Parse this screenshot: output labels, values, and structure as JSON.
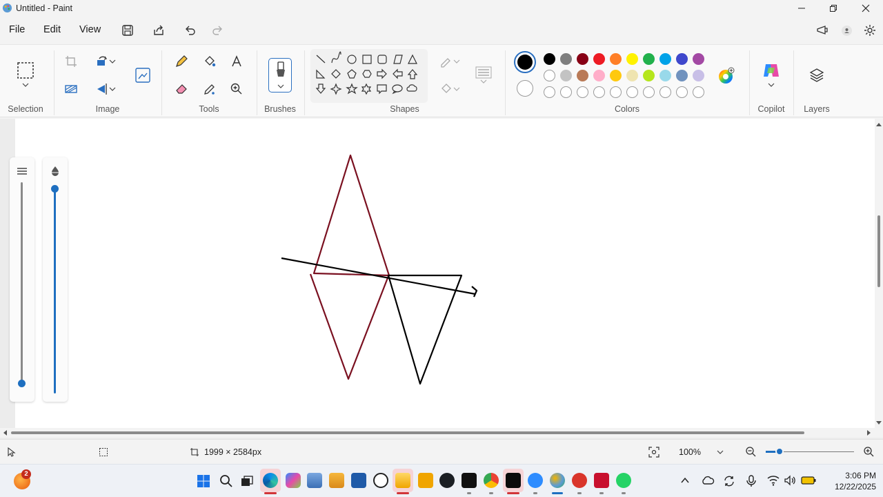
{
  "window": {
    "title": "Untitled - Paint",
    "minimize_icon": "minimize-icon",
    "maximize_icon": "restore-icon",
    "close_icon": "close-icon"
  },
  "menu": {
    "items": [
      "File",
      "Edit",
      "View"
    ],
    "quick_actions": [
      "save-icon",
      "share-icon",
      "undo-icon",
      "redo-icon"
    ]
  },
  "ribbon": {
    "groups": {
      "selection": "Selection",
      "image": "Image",
      "tools": "Tools",
      "brushes": "Brushes",
      "shapes": "Shapes",
      "colors": "Colors",
      "copilot": "Copilot",
      "layers": "Layers"
    },
    "colors": {
      "primary": "#000000",
      "secondary": "#ffffff",
      "palette_row1": [
        "#000000",
        "#7f7f7f",
        "#880015",
        "#ed1c24",
        "#ff7f27",
        "#fff200",
        "#22b14c",
        "#00a2e8",
        "#3f48cc",
        "#a349a4"
      ],
      "palette_row2": [
        "#ffffff",
        "#c3c3c3",
        "#b97a57",
        "#ffaec9",
        "#ffc90e",
        "#efe4b0",
        "#b5e61d",
        "#99d9ea",
        "#7092be",
        "#c8bfe7"
      ]
    }
  },
  "canvas": {
    "stroke_dark_red": "#7a1020",
    "stroke_black": "#000000"
  },
  "status": {
    "canvas_size": "1999 × 2584px",
    "zoom": "100%"
  },
  "taskbar": {
    "notification_count": "2",
    "time": "3:06 PM",
    "date": "12/22/2025"
  }
}
